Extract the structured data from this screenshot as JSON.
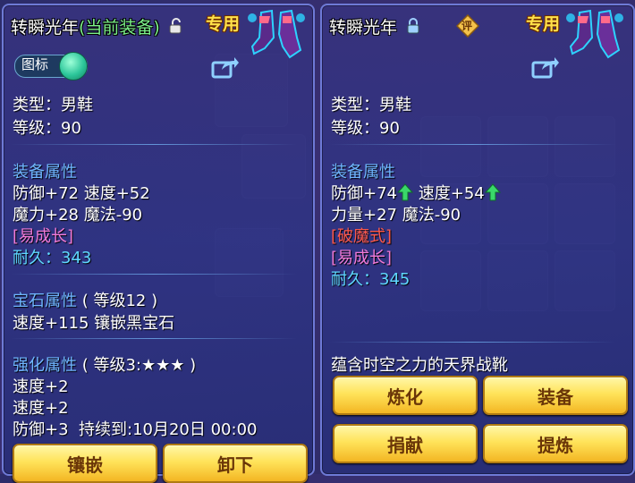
{
  "left": {
    "title_main": "转瞬光年",
    "title_paren": "(当前装备)",
    "special_tag": "专用",
    "icon_toggle_label": "图标",
    "type_line": "类型：男鞋",
    "level_line": "等级：90",
    "equip_attr_header": "装备属性",
    "attr_line1": "防御+72 速度+52",
    "attr_line2": "魔力+28 魔法-90",
    "tag_grow": "[易成长]",
    "durability_label": "耐久：",
    "durability_value": "343",
    "gem_header": "宝石属性",
    "gem_level": "( 等级12 )",
    "gem_line": "速度+115 镶嵌黑宝石",
    "enhance_header": "强化属性",
    "enhance_level": "( 等级3:★★★ )",
    "enhance_line1": "速度+2",
    "enhance_line2": "速度+2",
    "enhance_line3": "防御+3",
    "enhance_duration": "持续到:10月20日 00:00",
    "btn_inlay": "镶嵌",
    "btn_unload": "卸下"
  },
  "right": {
    "title_main": "转瞬光年",
    "rate_badge": "评",
    "special_tag": "专用",
    "type_line": "类型：男鞋",
    "level_line": "等级：90",
    "equip_attr_header": "装备属性",
    "attr1_a": "防御+74",
    "attr1_b": "速度+54",
    "attr_line2": "力量+27 魔法-90",
    "tag_break": "[破魔式]",
    "tag_grow": "[易成长]",
    "durability_label": "耐久：",
    "durability_value": "345",
    "description": "蕴含时空之力的天界战靴",
    "btn_refine": "炼化",
    "btn_equip": "装备",
    "btn_donate": "捐献",
    "btn_extract": "提炼"
  },
  "colors": {
    "header_blue": "#6fb6ff",
    "durability_cyan": "#5fd8ff",
    "tag_pink": "#f07ad8",
    "tag_red": "#ff5a4e",
    "special_gold": "#ffe14a",
    "up_arrow_green": "#3ad86a"
  }
}
